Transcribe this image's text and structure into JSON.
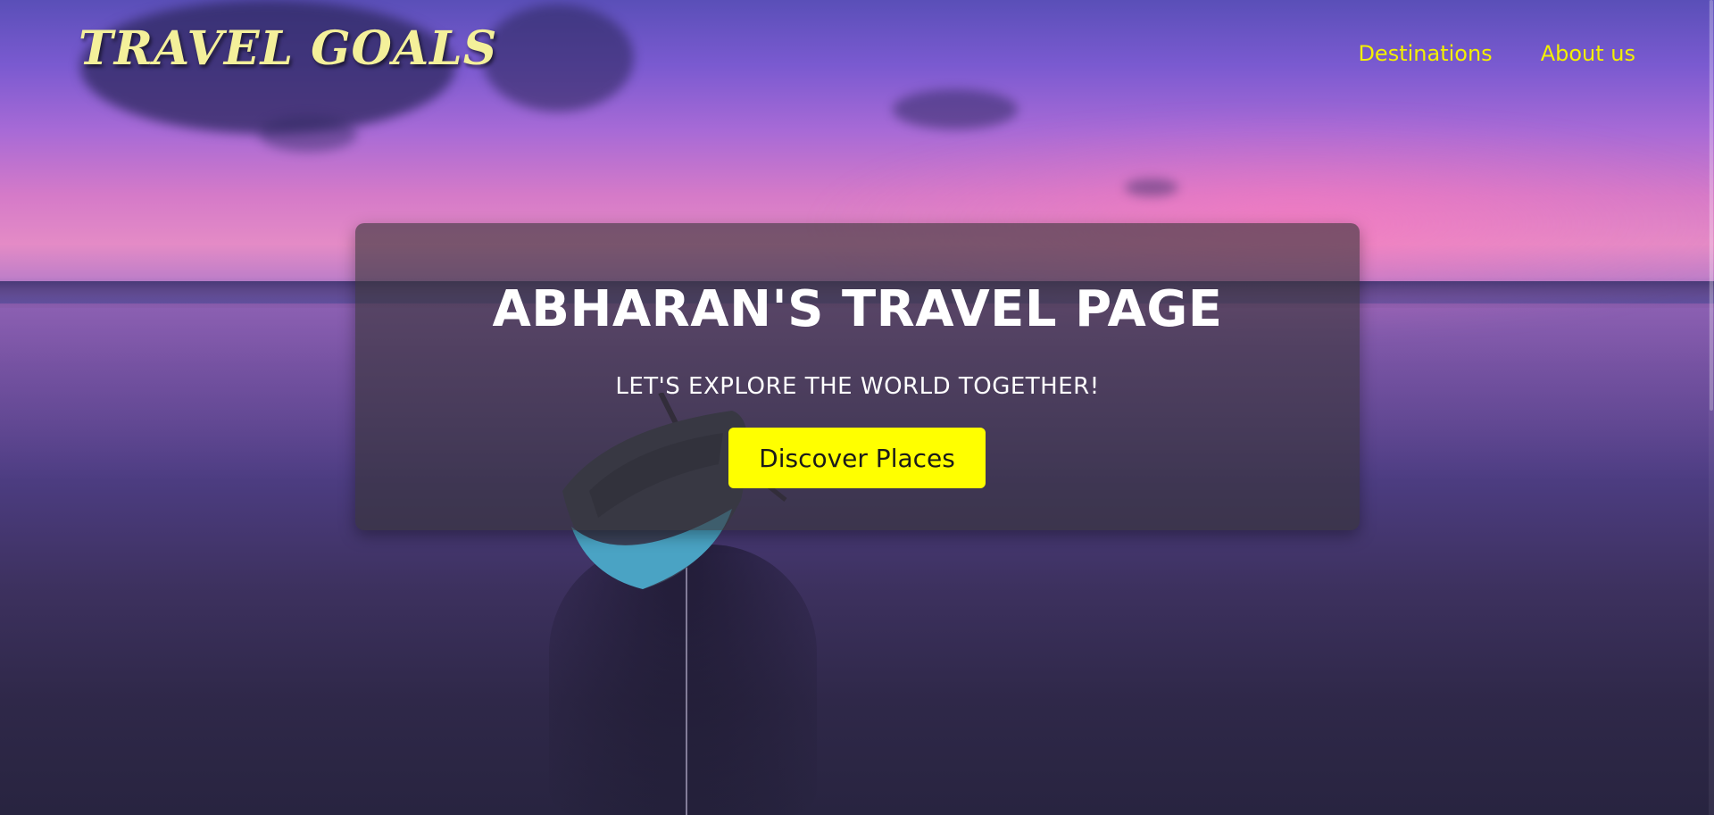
{
  "header": {
    "logo": "TRAVEL GOALS",
    "nav": [
      {
        "label": "Destinations"
      },
      {
        "label": "About us"
      }
    ]
  },
  "hero": {
    "title": "ABHARAN'S TRAVEL PAGE",
    "subtitle": "LET'S EXPLORE THE WORLD TOGETHER!",
    "cta_label": "Discover Places"
  },
  "colors": {
    "accent": "#f3f000",
    "logo": "#f4f09a",
    "card_bg": "rgba(55,52,55,0.62)"
  }
}
